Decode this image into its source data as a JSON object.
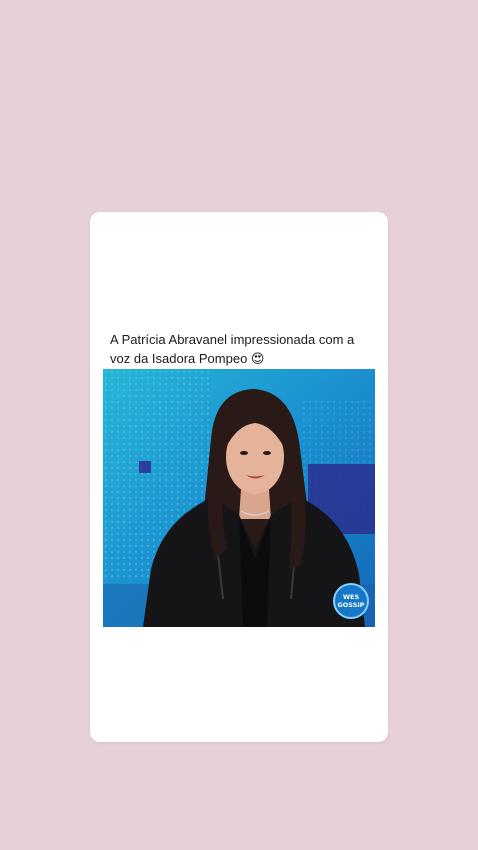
{
  "post": {
    "caption": "A Patrícia Abravanel impressionada com a voz da Isadora Pompeo 😍"
  },
  "video": {
    "watermark_line1": "WES",
    "watermark_line2": "GOSSIP"
  },
  "colors": {
    "page_background": "#e6d2d6",
    "card_background": "#ffffff",
    "stage_blue": "#1d7fc4",
    "watermark_badge": "#1677c6"
  }
}
